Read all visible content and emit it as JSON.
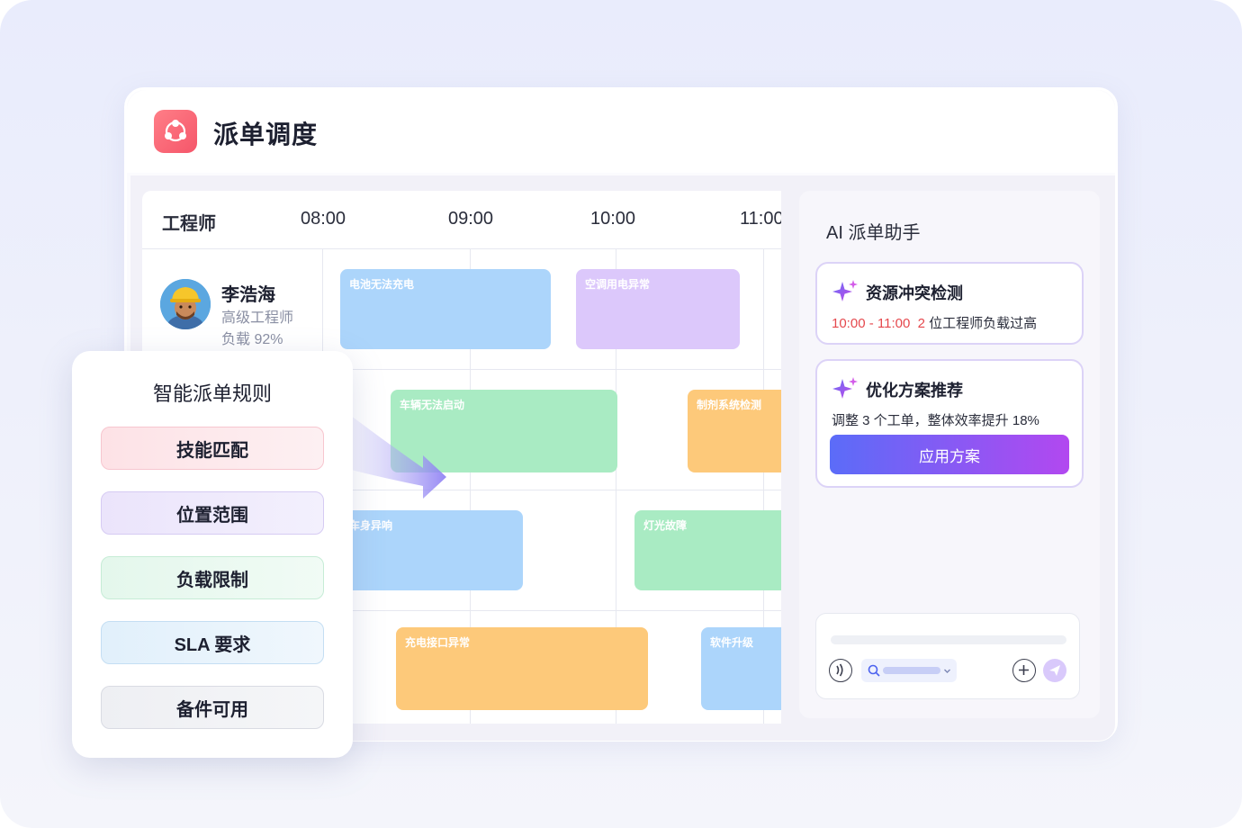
{
  "app": {
    "title": "派单调度"
  },
  "schedule": {
    "column_engineer": "工程师",
    "times": [
      "08:00",
      "09:00",
      "10:00",
      "11:00"
    ],
    "engineer": {
      "name": "李浩海",
      "role": "高级工程师",
      "load": "负载 92%"
    },
    "tasks": [
      "电池无法充电",
      "空调用电异常",
      "车辆无法启动",
      "制剂系统检测",
      "车身异响",
      "灯光故障",
      "充电接口异常",
      "软件升级"
    ]
  },
  "rules": {
    "title": "智能派单规则",
    "items": [
      "技能匹配",
      "位置范围",
      "负载限制",
      "SLA 要求",
      "备件可用"
    ]
  },
  "ai": {
    "title": "AI 派单助手",
    "conflict": {
      "title": "资源冲突检测",
      "time": "10:00 - 11:00",
      "detail": "2 位工程师负载过高"
    },
    "optimize": {
      "title": "优化方案推荐",
      "detail": "调整 3 个工单，整体效率提升 18%",
      "button": "应用方案"
    }
  },
  "colors": {
    "accent_gradient_start": "#5b6cf8",
    "accent_gradient_end": "#b248f0",
    "alert_red": "#e5484d",
    "app_icon": "#f5566a"
  },
  "icons": [
    "app-logo-icon",
    "sparkle-icon",
    "voice-icon",
    "search-icon",
    "chevron-down-icon",
    "plus-icon",
    "send-icon",
    "arrow-right-icon"
  ]
}
